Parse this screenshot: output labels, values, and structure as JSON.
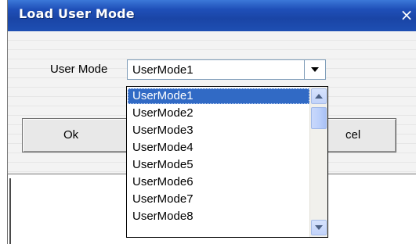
{
  "dialog": {
    "title": "Load User Mode",
    "close_glyph": "×",
    "close_icon": "close-icon"
  },
  "form": {
    "user_mode_label": "User Mode",
    "user_mode_value": "UserMode1"
  },
  "buttons": {
    "ok_label": "Ok",
    "cancel_label_visible": "cel"
  },
  "dropdown": {
    "options": [
      "UserMode1",
      "UserMode2",
      "UserMode3",
      "UserMode4",
      "UserMode5",
      "UserMode6",
      "UserMode7",
      "UserMode8"
    ],
    "selected_index": 0
  },
  "colors": {
    "titlebar": "#1f4fb8",
    "selection": "#316ac5"
  }
}
